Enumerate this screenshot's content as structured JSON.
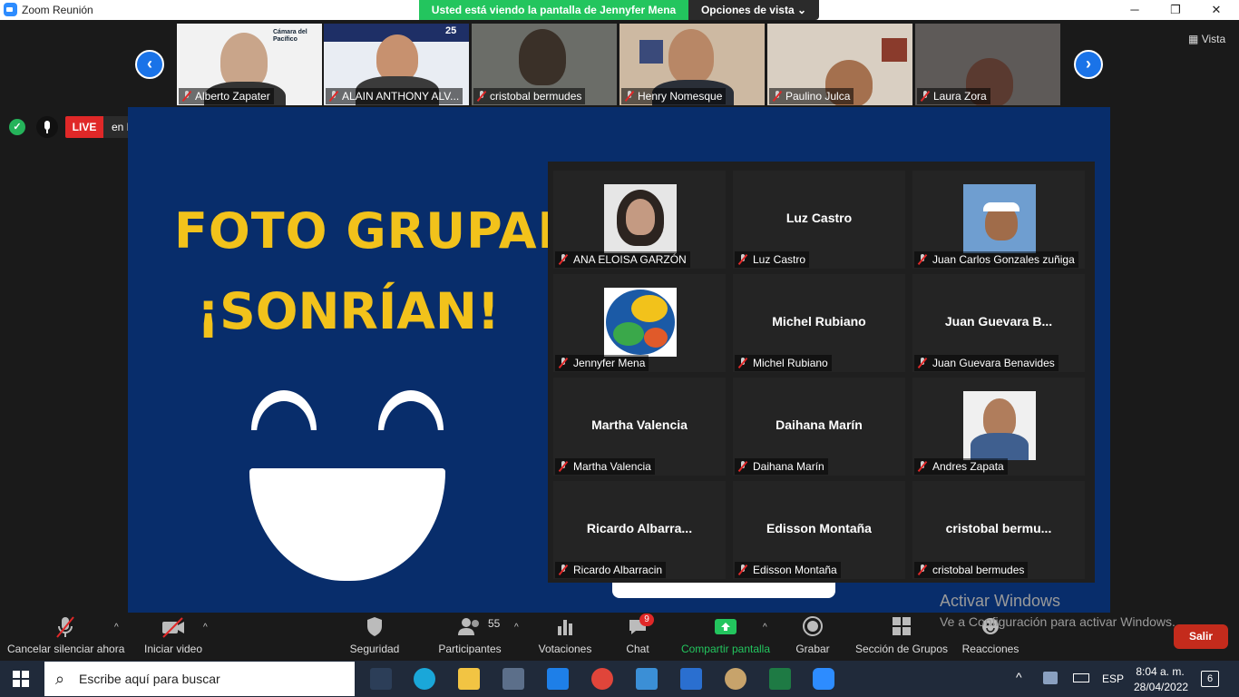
{
  "window": {
    "title": "Zoom Reunión",
    "share_banner": "Usted está viendo la pantalla de Jennyfer Mena",
    "view_options": "Opciones de vista"
  },
  "strip": {
    "vista_label": "Vista",
    "participants": [
      {
        "name": "Alberto Zapater"
      },
      {
        "name": "ALAIN ANTHONY ALV..."
      },
      {
        "name": "cristobal bermudes"
      },
      {
        "name": "Henry Nomesque"
      },
      {
        "name": "Paulino Julca"
      },
      {
        "name": "Laura Zora"
      }
    ],
    "logo_text_1": "Cámara del",
    "logo_text_2": "Pacífico",
    "badge_25": "25"
  },
  "status": {
    "live": "LIVE",
    "destination": "en Facebook"
  },
  "slide": {
    "line1": "FOTO GRUPAL",
    "line2": "¡SONRÍAN!"
  },
  "gallery": {
    "tiles": [
      {
        "label": "ANA ELOISA GARZÓN",
        "display": ""
      },
      {
        "label": "Luz Castro",
        "display": "Luz Castro"
      },
      {
        "label": "Juan Carlos Gonzales zuñiga",
        "display": ""
      },
      {
        "label": "Jennyfer Mena",
        "display": ""
      },
      {
        "label": "Michel Rubiano",
        "display": "Michel Rubiano"
      },
      {
        "label": "Juan Guevara Benavides",
        "display": "Juan Guevara B..."
      },
      {
        "label": "Martha Valencia",
        "display": "Martha Valencia"
      },
      {
        "label": "Daihana Marín",
        "display": "Daihana Marín"
      },
      {
        "label": "Andres Zapata",
        "display": ""
      },
      {
        "label": "Ricardo Albarracin",
        "display": "Ricardo  Albarra..."
      },
      {
        "label": "Edisson Montaña",
        "display": "Edisson Montaña"
      },
      {
        "label": "cristobal bermudes",
        "display": "cristobal  bermu..."
      }
    ]
  },
  "watermark": {
    "line1": "Activar Windows",
    "line2": "Ve a Configuración para activar Windows."
  },
  "toolbar": {
    "unmute": "Cancelar silenciar ahora",
    "start_video": "Iniciar video",
    "security": "Seguridad",
    "participants": "Participantes",
    "participants_count": "55",
    "polls": "Votaciones",
    "chat": "Chat",
    "chat_badge": "9",
    "share": "Compartir pantalla",
    "record": "Grabar",
    "breakout": "Sección de Grupos",
    "reactions": "Reacciones",
    "leave": "Salir"
  },
  "taskbar": {
    "search_placeholder": "Escribe aquí para buscar",
    "lang": "ESP",
    "time": "8:04 a. m.",
    "date": "28/04/2022",
    "notif_count": "6"
  },
  "colors": {
    "slide_bg": "#082d6b",
    "slide_text": "#f2c21b",
    "share_green": "#23c55e",
    "live_red": "#e02828",
    "leave_red": "#c42b1c"
  }
}
